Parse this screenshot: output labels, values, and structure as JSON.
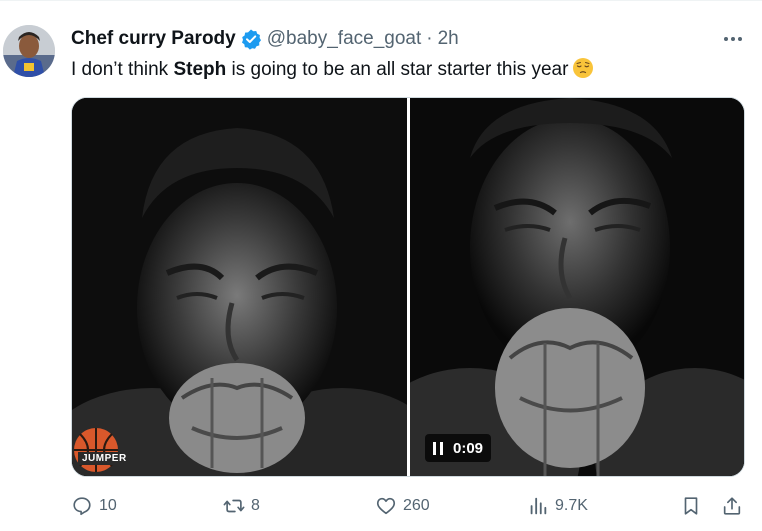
{
  "author": {
    "display_name": "Chef curry Parody",
    "handle": "@baby_face_goat",
    "separator": "·",
    "time": "2h",
    "verified": true
  },
  "tweet": {
    "text_before": "I don’t think ",
    "text_bold": "Steph",
    "text_after": " is going to be an all star starter this year",
    "emoji": "pensive-face"
  },
  "media": {
    "watermark": "JUMPER",
    "video_time": "0:09",
    "video_state": "playing"
  },
  "actions": {
    "replies": "10",
    "reposts": "8",
    "likes": "260",
    "views": "9.7K"
  },
  "colors": {
    "text_primary": "#0f1419",
    "text_secondary": "#536471",
    "verified_blue": "#1d9bf0",
    "border": "#cfd9de"
  }
}
